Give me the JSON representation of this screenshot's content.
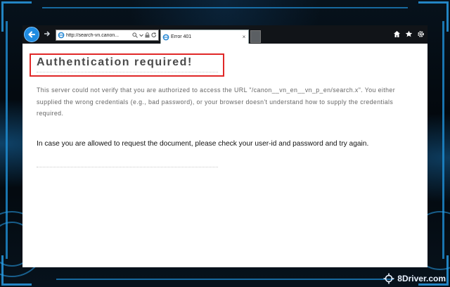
{
  "browser": {
    "address_url": "http://search-vn.canon...",
    "tab_title": "Error 401",
    "tab_close": "×"
  },
  "page": {
    "title": "Authentication required!",
    "message": "This server could not verify that you are authorized to access the URL \"/canon__vn_en__vn_p_en/search.x\". You either supplied the wrong credentials (e.g., bad password), or your browser doesn't understand how to supply the credentials required.",
    "instruction": "In case you are allowed to request the document, please check your user-id and password and try again."
  },
  "watermark": {
    "text": "8Driver.com"
  },
  "icons": {
    "back": "back-arrow-icon",
    "forward": "forward-arrow-icon",
    "site": "ie-logo-icon",
    "search": "search-icon",
    "dropdown": "dropdown-icon",
    "lock": "lock-icon",
    "refresh": "refresh-icon",
    "home": "home-icon",
    "favorites": "star-icon",
    "settings": "gear-icon"
  },
  "colors": {
    "accent_blue": "#1f8be0",
    "highlight_red": "#e02828",
    "toolbar": "#111418"
  }
}
